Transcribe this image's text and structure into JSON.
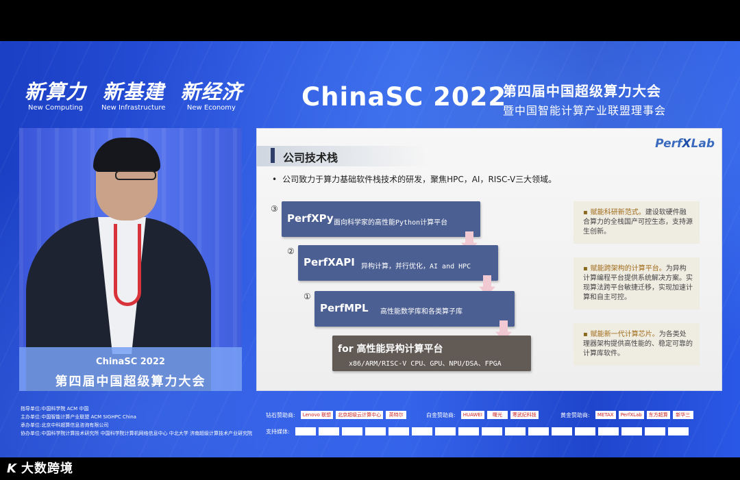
{
  "header": {
    "slogans": [
      {
        "zh": "新算力",
        "en": "New  Computing"
      },
      {
        "zh": "新基建",
        "en": "New  Infrastructure"
      },
      {
        "zh": "新经济",
        "en": "New  Economy"
      }
    ],
    "brand": "ChinaSC 2022",
    "conference_line1": "第四届中国超级算力大会",
    "conference_line2": "暨中国智能计算产业联盟理事会"
  },
  "speaker_panel": {
    "podium_line1": "ChinaSC 2022",
    "podium_line2": "第四届中国超级算力大会"
  },
  "slide": {
    "title": "公司技术栈",
    "logo_a": "Perf",
    "logo_x": "X",
    "logo_b": "Lab",
    "bullet": "公司致力于算力基础软件栈技术的研发，聚焦HPC，AI，RISC-V三大领域。",
    "stack": [
      {
        "num": "③",
        "name": "PerfXPy",
        "desc": "面向科学家的高性能Python计算平台"
      },
      {
        "num": "②",
        "name": "PerfXAPI",
        "desc": "异构计算，并行优化，AI and HPC"
      },
      {
        "num": "①",
        "name": "PerfMPL",
        "desc": "高性能数学库和各类算子库"
      },
      {
        "num": "",
        "name": "for 高性能异构计算平台",
        "desc": "x86/ARM/RISC-V CPU、GPU、NPU/DSA、FPGA"
      }
    ],
    "notes": [
      {
        "head": "赋能科研新范式。",
        "body": "建设软硬件融合算力的全栈国产可控生态，支持源生创新。"
      },
      {
        "head": "赋能跨架构的计算平台。",
        "body": "为异构计算编程平台提供系统解决方案。实现算法跨平台敏捷迁移，实现加速计算和自主可控。"
      },
      {
        "head": "赋能新一代计算芯片。",
        "body": "为各类处理器架构提供高性能的、稳定可靠的计算库软件。"
      }
    ]
  },
  "sponsors": {
    "guide": "指导单位:中国科学院   ACM 中国",
    "host": "主办单位:中国智能计算产业联盟   ACM SIGHPC China",
    "organizer": "承办单位:北京中科超算信息咨询有限公司",
    "co_organizer": "协办单位:中国科学院计算技术研究所   中国科学院计算机网络信息中心   中北大学   济南超级计算技术产业研究院",
    "diamond_label": "钻石赞助商:",
    "diamond": [
      "Lenovo 联想",
      "北京超级云计算中心",
      "英特尔"
    ],
    "platinum_label": "白金赞助商:",
    "platinum": [
      "HUAWEI",
      "曙光",
      "寒武纪科技"
    ],
    "gold_label": "黄金赞助商:",
    "gold": [
      "METAX",
      "PerfXLab",
      "东方超算",
      "新华三"
    ],
    "media_label": "支持媒体:"
  },
  "watermark": "大数跨境"
}
